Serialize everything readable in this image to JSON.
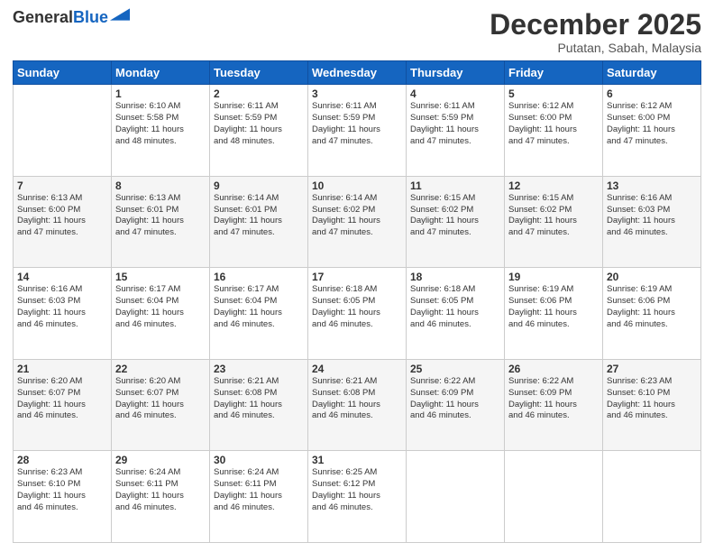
{
  "logo": {
    "line1": "General",
    "line2": "Blue"
  },
  "header": {
    "month": "December 2025",
    "location": "Putatan, Sabah, Malaysia"
  },
  "days_of_week": [
    "Sunday",
    "Monday",
    "Tuesday",
    "Wednesday",
    "Thursday",
    "Friday",
    "Saturday"
  ],
  "weeks": [
    [
      {
        "num": "",
        "info": ""
      },
      {
        "num": "1",
        "info": "Sunrise: 6:10 AM\nSunset: 5:58 PM\nDaylight: 11 hours\nand 48 minutes."
      },
      {
        "num": "2",
        "info": "Sunrise: 6:11 AM\nSunset: 5:59 PM\nDaylight: 11 hours\nand 48 minutes."
      },
      {
        "num": "3",
        "info": "Sunrise: 6:11 AM\nSunset: 5:59 PM\nDaylight: 11 hours\nand 47 minutes."
      },
      {
        "num": "4",
        "info": "Sunrise: 6:11 AM\nSunset: 5:59 PM\nDaylight: 11 hours\nand 47 minutes."
      },
      {
        "num": "5",
        "info": "Sunrise: 6:12 AM\nSunset: 6:00 PM\nDaylight: 11 hours\nand 47 minutes."
      },
      {
        "num": "6",
        "info": "Sunrise: 6:12 AM\nSunset: 6:00 PM\nDaylight: 11 hours\nand 47 minutes."
      }
    ],
    [
      {
        "num": "7",
        "info": "Sunrise: 6:13 AM\nSunset: 6:00 PM\nDaylight: 11 hours\nand 47 minutes."
      },
      {
        "num": "8",
        "info": "Sunrise: 6:13 AM\nSunset: 6:01 PM\nDaylight: 11 hours\nand 47 minutes."
      },
      {
        "num": "9",
        "info": "Sunrise: 6:14 AM\nSunset: 6:01 PM\nDaylight: 11 hours\nand 47 minutes."
      },
      {
        "num": "10",
        "info": "Sunrise: 6:14 AM\nSunset: 6:02 PM\nDaylight: 11 hours\nand 47 minutes."
      },
      {
        "num": "11",
        "info": "Sunrise: 6:15 AM\nSunset: 6:02 PM\nDaylight: 11 hours\nand 47 minutes."
      },
      {
        "num": "12",
        "info": "Sunrise: 6:15 AM\nSunset: 6:02 PM\nDaylight: 11 hours\nand 47 minutes."
      },
      {
        "num": "13",
        "info": "Sunrise: 6:16 AM\nSunset: 6:03 PM\nDaylight: 11 hours\nand 46 minutes."
      }
    ],
    [
      {
        "num": "14",
        "info": "Sunrise: 6:16 AM\nSunset: 6:03 PM\nDaylight: 11 hours\nand 46 minutes."
      },
      {
        "num": "15",
        "info": "Sunrise: 6:17 AM\nSunset: 6:04 PM\nDaylight: 11 hours\nand 46 minutes."
      },
      {
        "num": "16",
        "info": "Sunrise: 6:17 AM\nSunset: 6:04 PM\nDaylight: 11 hours\nand 46 minutes."
      },
      {
        "num": "17",
        "info": "Sunrise: 6:18 AM\nSunset: 6:05 PM\nDaylight: 11 hours\nand 46 minutes."
      },
      {
        "num": "18",
        "info": "Sunrise: 6:18 AM\nSunset: 6:05 PM\nDaylight: 11 hours\nand 46 minutes."
      },
      {
        "num": "19",
        "info": "Sunrise: 6:19 AM\nSunset: 6:06 PM\nDaylight: 11 hours\nand 46 minutes."
      },
      {
        "num": "20",
        "info": "Sunrise: 6:19 AM\nSunset: 6:06 PM\nDaylight: 11 hours\nand 46 minutes."
      }
    ],
    [
      {
        "num": "21",
        "info": "Sunrise: 6:20 AM\nSunset: 6:07 PM\nDaylight: 11 hours\nand 46 minutes."
      },
      {
        "num": "22",
        "info": "Sunrise: 6:20 AM\nSunset: 6:07 PM\nDaylight: 11 hours\nand 46 minutes."
      },
      {
        "num": "23",
        "info": "Sunrise: 6:21 AM\nSunset: 6:08 PM\nDaylight: 11 hours\nand 46 minutes."
      },
      {
        "num": "24",
        "info": "Sunrise: 6:21 AM\nSunset: 6:08 PM\nDaylight: 11 hours\nand 46 minutes."
      },
      {
        "num": "25",
        "info": "Sunrise: 6:22 AM\nSunset: 6:09 PM\nDaylight: 11 hours\nand 46 minutes."
      },
      {
        "num": "26",
        "info": "Sunrise: 6:22 AM\nSunset: 6:09 PM\nDaylight: 11 hours\nand 46 minutes."
      },
      {
        "num": "27",
        "info": "Sunrise: 6:23 AM\nSunset: 6:10 PM\nDaylight: 11 hours\nand 46 minutes."
      }
    ],
    [
      {
        "num": "28",
        "info": "Sunrise: 6:23 AM\nSunset: 6:10 PM\nDaylight: 11 hours\nand 46 minutes."
      },
      {
        "num": "29",
        "info": "Sunrise: 6:24 AM\nSunset: 6:11 PM\nDaylight: 11 hours\nand 46 minutes."
      },
      {
        "num": "30",
        "info": "Sunrise: 6:24 AM\nSunset: 6:11 PM\nDaylight: 11 hours\nand 46 minutes."
      },
      {
        "num": "31",
        "info": "Sunrise: 6:25 AM\nSunset: 6:12 PM\nDaylight: 11 hours\nand 46 minutes."
      },
      {
        "num": "",
        "info": ""
      },
      {
        "num": "",
        "info": ""
      },
      {
        "num": "",
        "info": ""
      }
    ]
  ]
}
